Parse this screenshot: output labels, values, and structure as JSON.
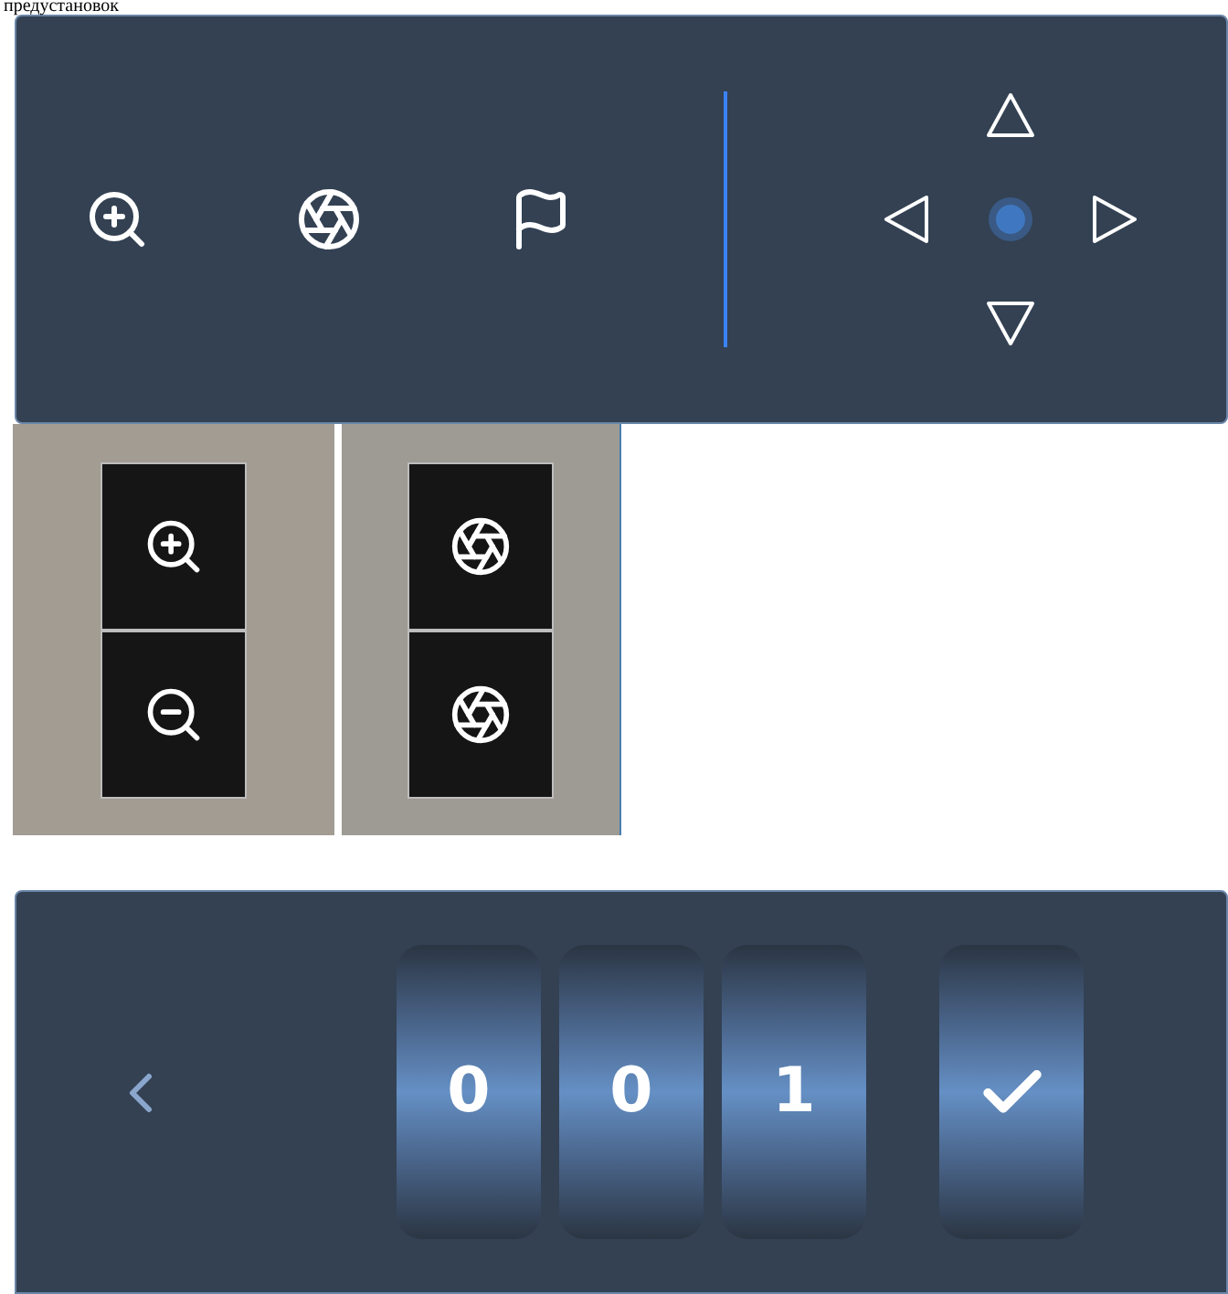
{
  "heading": "предустановок",
  "preset_digits": [
    "0",
    "0",
    "1"
  ]
}
